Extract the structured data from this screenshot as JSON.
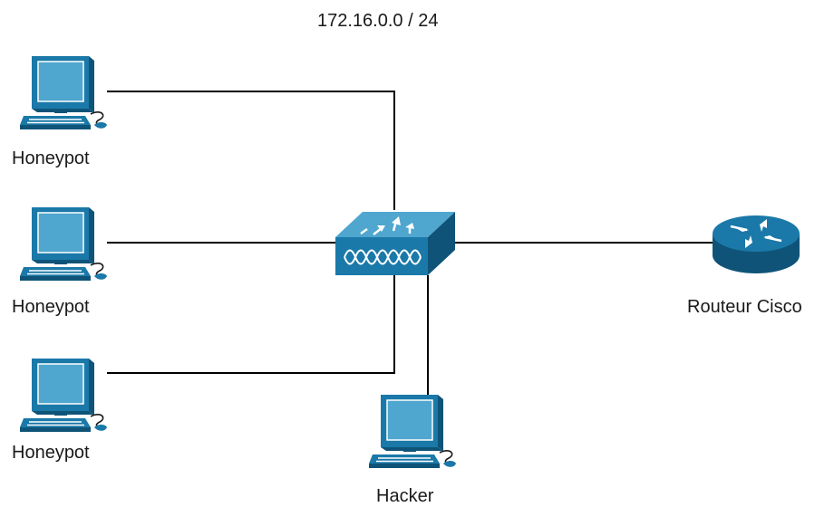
{
  "title": "172.16.0.0 / 24",
  "nodes": {
    "honeypot1": {
      "label": "Honeypot"
    },
    "honeypot2": {
      "label": "Honeypot"
    },
    "honeypot3": {
      "label": "Honeypot"
    },
    "hacker": {
      "label": "Hacker"
    },
    "router": {
      "label": "Routeur Cisco"
    },
    "switch": {
      "label": ""
    }
  },
  "colors": {
    "device_blue": "#1a79a8",
    "device_dark": "#0f5478",
    "device_light": "#4fa6cf",
    "line": "#000000",
    "text": "#1a1a1a"
  }
}
